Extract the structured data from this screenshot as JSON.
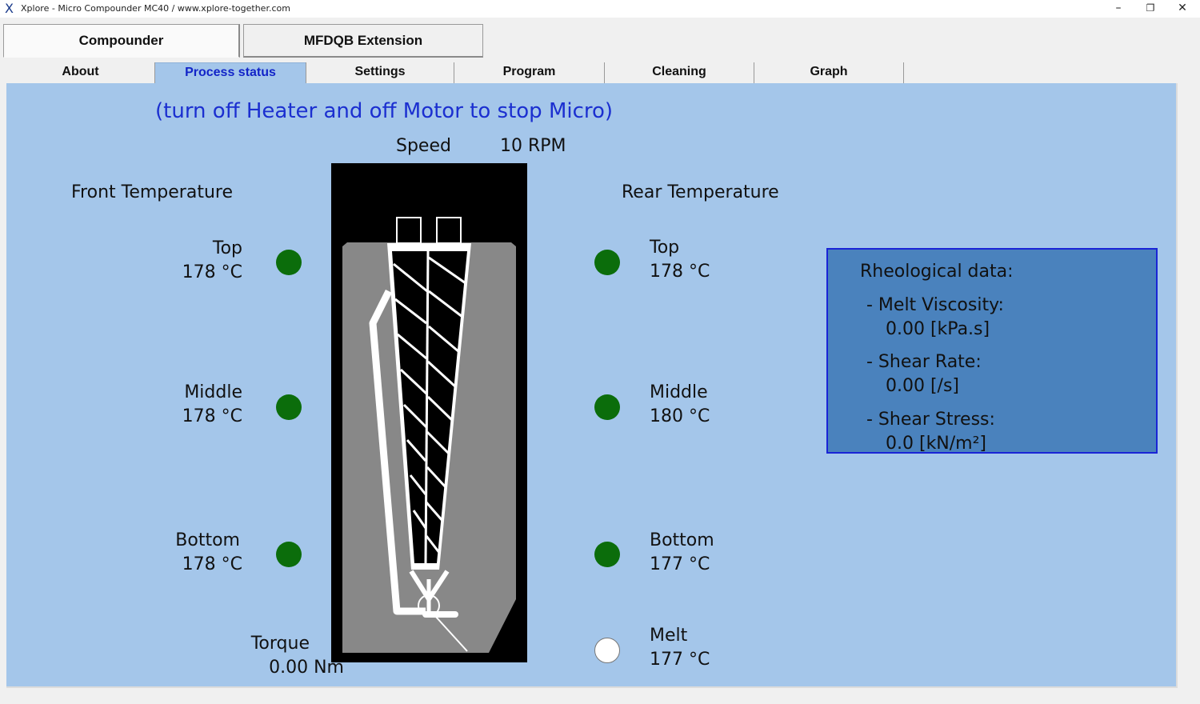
{
  "window": {
    "app_icon": "X",
    "title": "Xplore - Micro Compounder MC40 / www.xplore-together.com",
    "controls": {
      "minimize": "–",
      "maximize": "❐",
      "close": "✕"
    }
  },
  "main_tabs": [
    {
      "label": "Compounder"
    },
    {
      "label": "MFDQB Extension"
    }
  ],
  "sub_tabs": [
    {
      "label": "About"
    },
    {
      "label": "Process status",
      "active": true
    },
    {
      "label": "Settings"
    },
    {
      "label": "Program"
    },
    {
      "label": "Cleaning"
    },
    {
      "label": "Graph"
    }
  ],
  "process": {
    "warning": "(turn off Heater and off Motor to stop Micro)",
    "speed_label": "Speed",
    "speed_value": "10 RPM",
    "front_title": "Front Temperature",
    "rear_title": "Rear Temperature",
    "front": {
      "top": {
        "label": "Top",
        "value": "178 °C"
      },
      "middle": {
        "label": "Middle",
        "value": "178 °C"
      },
      "bottom": {
        "label": "Bottom",
        "value": "178 °C"
      }
    },
    "rear": {
      "top": {
        "label": "Top",
        "value": "178 °C"
      },
      "middle": {
        "label": "Middle",
        "value": "180 °C"
      },
      "bottom": {
        "label": "Bottom",
        "value": "177 °C"
      },
      "melt": {
        "label": "Melt",
        "value": "177 °C"
      }
    },
    "torque_label": "Torque",
    "torque_value": "0.00 Nm",
    "indicator_colors": {
      "on": "#0b6d0b",
      "off": "#ffffff"
    }
  },
  "rheology": {
    "title": "Rheological data:",
    "viscosity_label": "- Melt Viscosity:",
    "viscosity_value": "0.00 [kPa.s]",
    "shear_rate_label": "- Shear Rate:",
    "shear_rate_value": "0.00 [/s]",
    "shear_stress_label": "- Shear Stress:",
    "shear_stress_value": "0.0 [kN/m²]"
  },
  "colors": {
    "panel_bg": "#a4c6ea",
    "rheo_bg": "#4a82bd",
    "rheo_border": "#1a24d6",
    "warning_text": "#1b2fd0",
    "active_tab_text": "#1224c8"
  }
}
